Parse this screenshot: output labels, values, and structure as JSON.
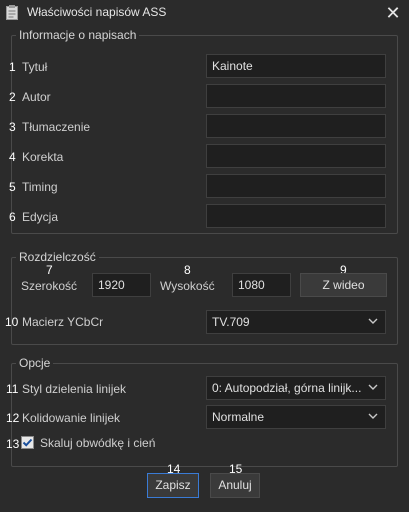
{
  "window": {
    "title": "Właściwości napisów ASS",
    "close": "✕"
  },
  "info": {
    "legend": "Informacje o napisach",
    "rows": [
      {
        "num": "1",
        "label": "Tytuł",
        "value": "Kainote"
      },
      {
        "num": "2",
        "label": "Autor",
        "value": ""
      },
      {
        "num": "3",
        "label": "Tłumaczenie",
        "value": ""
      },
      {
        "num": "4",
        "label": "Korekta",
        "value": ""
      },
      {
        "num": "5",
        "label": "Timing",
        "value": ""
      },
      {
        "num": "6",
        "label": "Edycja",
        "value": ""
      }
    ]
  },
  "resolution": {
    "legend": "Rozdzielczość",
    "width_num": "7",
    "width_label": "Szerokość",
    "width_value": "1920",
    "height_num": "8",
    "height_label": "Wysokość",
    "height_value": "1080",
    "from_video_num": "9",
    "from_video_label": "Z wideo",
    "matrix_num": "10",
    "matrix_label": "Macierz YCbCr",
    "matrix_value": "TV.709"
  },
  "options": {
    "legend": "Opcje",
    "wrap_num": "11",
    "wrap_label": "Styl dzielenia linijek",
    "wrap_value": "0: Autopodział, górna linijk...",
    "collision_num": "12",
    "collision_label": "Kolidowanie linijek",
    "collision_value": "Normalne",
    "scale_num": "13",
    "scale_label": "Skaluj obwódkę i cień",
    "scale_checked": true
  },
  "buttons": {
    "save_num": "14",
    "save_label": "Zapisz",
    "cancel_num": "15",
    "cancel_label": "Anuluj"
  },
  "colors": {
    "background": "#2b2b2b",
    "field": "#1f1f1f",
    "accent": "#3a7bd5"
  }
}
